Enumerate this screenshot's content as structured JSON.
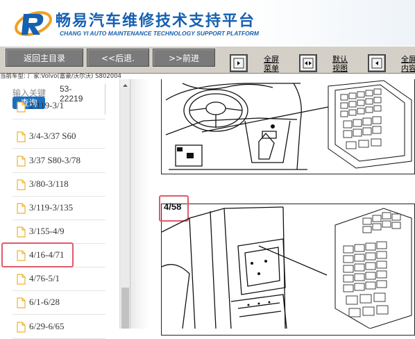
{
  "header": {
    "title_cn": "畅易汽车维修技术支持平台",
    "title_en": "CHANG YI AUTO MAINTENANCE TECHNOLOGY SUPPORT PLATFORM",
    "logo_icon": "changyi-logo-icon"
  },
  "toolbar": {
    "back_home": "返回主目录",
    "back": "<<后退.",
    "forward": ">>前进",
    "fullscreen_menu_line1": "全屏",
    "fullscreen_menu_line2": "菜单",
    "default_view_line1": "默认",
    "default_view_line2": "视图",
    "fullscreen_content_line1": "全屏",
    "fullscreen_content_line2": "内容"
  },
  "vehicle_info": "当前车型:   厂家:Volvo(富豪/沃尔沃) S802004",
  "sidebar": {
    "search_label": "输入关键",
    "search_button": "查询",
    "search_value_line1": "53-",
    "search_value_line2": "22219",
    "items": [
      {
        "label": "2/119-3/1"
      },
      {
        "label": "3/4-3/37 S60"
      },
      {
        "label": "3/37 S80-3/78"
      },
      {
        "label": "3/80-3/118"
      },
      {
        "label": "3/119-3/135"
      },
      {
        "label": "3/155-4/9"
      },
      {
        "label": "4/16-4/71"
      },
      {
        "label": "4/76-5/1"
      },
      {
        "label": "6/1-6/28"
      },
      {
        "label": "6/29-6/65"
      }
    ]
  },
  "viewer": {
    "page_number": "4/58"
  },
  "colors": {
    "brand_blue": "#1560b0",
    "search_button_bg": "#1c6fc0",
    "highlight_red": "#e05a6a",
    "toolbar_bg": "#d4d0c8",
    "nav_button_bg": "#7a7a7a"
  }
}
